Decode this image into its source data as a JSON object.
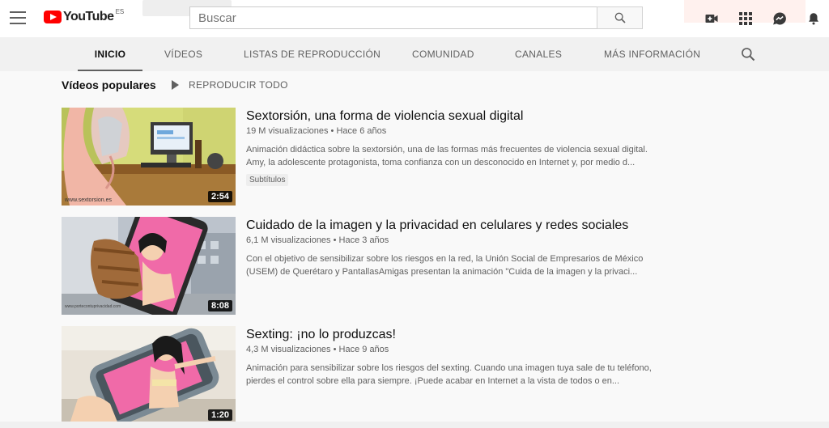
{
  "masthead": {
    "logo_text": "YouTube",
    "logo_country": "ES",
    "search_placeholder": "Buscar",
    "icons": [
      "menu-icon",
      "search-icon",
      "create-video-icon",
      "apps-grid-icon",
      "messages-icon",
      "notifications-bell-icon"
    ]
  },
  "tabs": [
    {
      "label": "INICIO",
      "active": true
    },
    {
      "label": "VÍDEOS",
      "active": false
    },
    {
      "label": "LISTAS DE REPRODUCCIÓN",
      "active": false
    },
    {
      "label": "COMUNIDAD",
      "active": false
    },
    {
      "label": "CANALES",
      "active": false
    },
    {
      "label": "MÁS INFORMACIÓN",
      "active": false
    }
  ],
  "section": {
    "title": "Vídeos populares",
    "play_all": "REPRODUCIR TODO"
  },
  "videos": [
    {
      "title": "Sextorsión, una forma de violencia sexual digital",
      "views": "19 M visualizaciones",
      "age": "Hace 6 años",
      "desc1": "Animación didáctica sobre la sextorsión, una de las formas más frecuentes de violencia sexual digital.",
      "desc2": "Amy, la adolescente protagonista, toma confianza con un desconocido en Internet y, por medio d...",
      "badge": "Subtítulos",
      "duration": "2:54",
      "watermark": "www.sextorsion.es"
    },
    {
      "title": "Cuidado de la imagen y la privacidad en celulares y redes sociales",
      "views": "6,1 M visualizaciones",
      "age": "Hace 3 años",
      "desc1": "Con el objetivo de sensibilizar sobre los riesgos en la red, la Unión Social de Empresarios de México",
      "desc2": "(USEM) de Querétaro y PantallasAmigas presentan la animación \"Cuida de la imagen y la privaci...",
      "duration": "8:08",
      "watermark": "www.portecontuprivacidad.com"
    },
    {
      "title": "Sexting: ¡no lo produzcas!",
      "views": "4,3 M visualizaciones",
      "age": "Hace 9 años",
      "desc1": "Animación para sensibilizar sobre los riesgos del sexting. Cuando una imagen tuya sale de tu teléfono,",
      "desc2": "pierdes el control sobre ella para siempre. ¡Puede acabar en Internet a la vista de todos o en...",
      "duration": "1:20"
    }
  ],
  "colors": {
    "brand_red": "#ff0000",
    "text_primary": "#0f0f0f",
    "text_secondary": "#606060",
    "tabbar_bg": "#f1f1f1",
    "page_bg": "#f9f9f9"
  }
}
